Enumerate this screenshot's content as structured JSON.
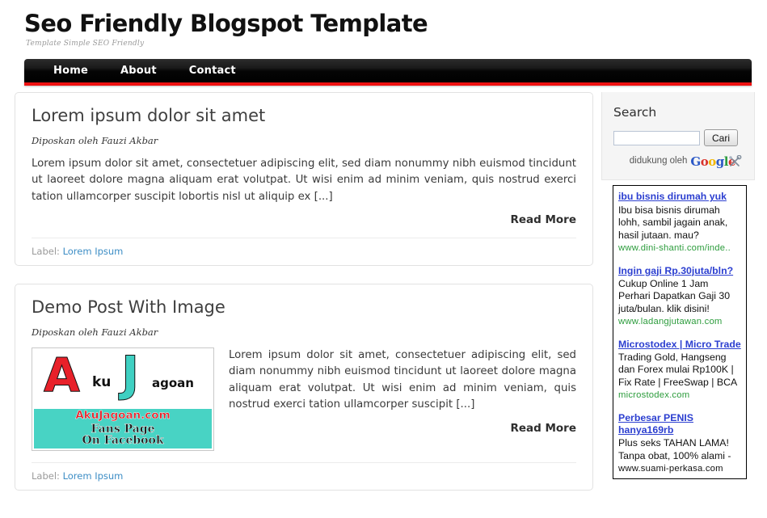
{
  "header": {
    "title": "Seo Friendly Blogspot Template",
    "tagline": "Template Simple SEO Friendly"
  },
  "nav": {
    "items": [
      {
        "label": "Home"
      },
      {
        "label": "About"
      },
      {
        "label": "Contact"
      }
    ],
    "background": "#000000",
    "accent": "#ee1111"
  },
  "posts": [
    {
      "title": "Lorem ipsum dolor sit amet",
      "meta": "Diposkan oleh Fauzi Akbar",
      "body": "Lorem ipsum dolor sit amet, consectetuer adipiscing elit, sed diam nonummy nibh euismod tincidunt ut laoreet dolore magna aliquam erat volutpat. Ut wisi enim ad minim veniam, quis nostrud exerci tation ullamcorper suscipit lobortis nisl ut aliquip ex [...]",
      "read_more": "Read More",
      "label_prefix": "Label:",
      "label": "Lorem Ipsum"
    },
    {
      "title": "Demo Post With Image",
      "meta": "Diposkan oleh Fauzi Akbar",
      "body": "Lorem ipsum dolor sit amet, consectetuer adipiscing elit, sed diam nonummy nibh euismod tincidunt ut laoreet dolore magna aliquam erat volutpat. Ut wisi enim ad minim veniam, quis nostrud exerci tation ullamcorper suscipit [...]",
      "read_more": "Read More",
      "label_prefix": "Label:",
      "label": "Lorem Ipsum",
      "thumbnail": {
        "logo_a": "A",
        "logo_ku": "ku",
        "logo_j": "J",
        "logo_jagoan": "agoan",
        "line1": "AkuJagoan.com",
        "line2": "Fans Page",
        "line3": "On Facebook"
      }
    }
  ],
  "sidebar": {
    "search": {
      "heading": "Search",
      "input_value": "",
      "placeholder": "",
      "button_label": "Cari",
      "powered_text": "didukung oleh",
      "google_letters": [
        "G",
        "o",
        "o",
        "g",
        "l",
        "e"
      ]
    },
    "ads": [
      {
        "title": "ibu bisnis dirumah yuk",
        "desc": "Ibu bisa bisnis dirumah lohh, sambil jagain anak, hasil jutaan. mau?",
        "url": "www.dini-shanti.com/inde..",
        "url_dark": false
      },
      {
        "title": "Ingin gaji Rp.30juta/bln?",
        "desc": "Cukup Online 1 Jam Perhari Dapatkan Gaji 30 juta/bulan. klik disini!",
        "url": "www.ladangjutawan.com",
        "url_dark": false
      },
      {
        "title": "Microstodex | Micro Trade",
        "desc": "Trading Gold, Hangseng dan Forex mulai Rp100K | Fix Rate | FreeSwap | BCA",
        "url": "microstodex.com",
        "url_dark": false
      },
      {
        "title": "Perbesar PENIS hanya169rb",
        "desc": "Plus seks TAHAN LAMA! Tanpa obat, 100% alami -",
        "url": "www.suami-perkasa.com",
        "url_dark": true
      }
    ]
  }
}
